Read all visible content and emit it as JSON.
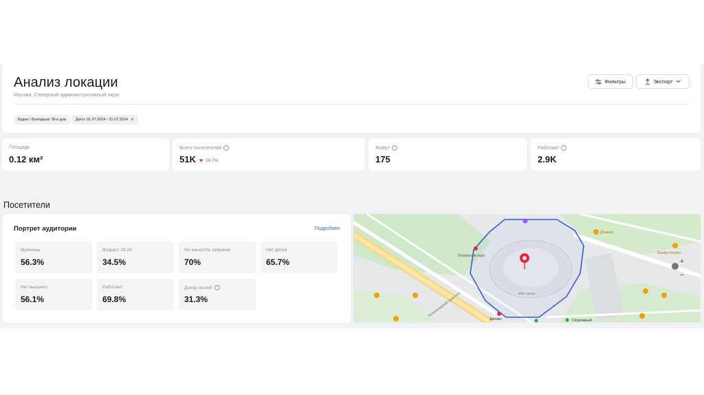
{
  "header": {
    "title": "Анализ локации",
    "subtitle": "Москва, Северный административный округ",
    "filters_button": "Фильтры",
    "export_button": "Экспорт"
  },
  "chips": [
    {
      "label": "Будни / Выходные: Все дни"
    },
    {
      "label": "Даты: 01.07.2024 - 31.07.2024"
    }
  ],
  "stats": [
    {
      "label": "Площадь",
      "value": "0.12 км²"
    },
    {
      "label": "Всего посетителей",
      "value": "51K",
      "change": "24.7%",
      "change_color": "#e0344b"
    },
    {
      "label": "Живут",
      "value": "175"
    },
    {
      "label": "Работают",
      "value": "2.9K"
    }
  ],
  "section": {
    "title": "Посетители"
  },
  "audience": {
    "title": "Портрет аудитории",
    "more_link": "Подробнее",
    "metrics": [
      {
        "label": "Мужчины",
        "value": "56.3%"
      },
      {
        "label": "Возраст 18-24",
        "value": "34.5%"
      },
      {
        "label": "Не женат/Не замужем",
        "value": "70%"
      },
      {
        "label": "Нет детей",
        "value": "65.7%"
      },
      {
        "label": "Нет высшего",
        "value": "56.1%"
      },
      {
        "label": "Работают",
        "value": "69.8%"
      },
      {
        "label": "Доход низкий",
        "value": "31.3%"
      }
    ]
  },
  "map": {
    "labels": {
      "park": "Петровский парк",
      "arena": "ВТБ Арена",
      "prospect": "Ленинградский проспект",
      "dinamo": "Динамо",
      "sportivny": "Спортивный",
      "gardens": "Garden Kitchen",
      "dosanko": "Дозанко"
    },
    "zoom_in": "+",
    "zoom_out": "−",
    "polygon_color": "#2d5fd8",
    "pin_color": "#e8293a"
  }
}
